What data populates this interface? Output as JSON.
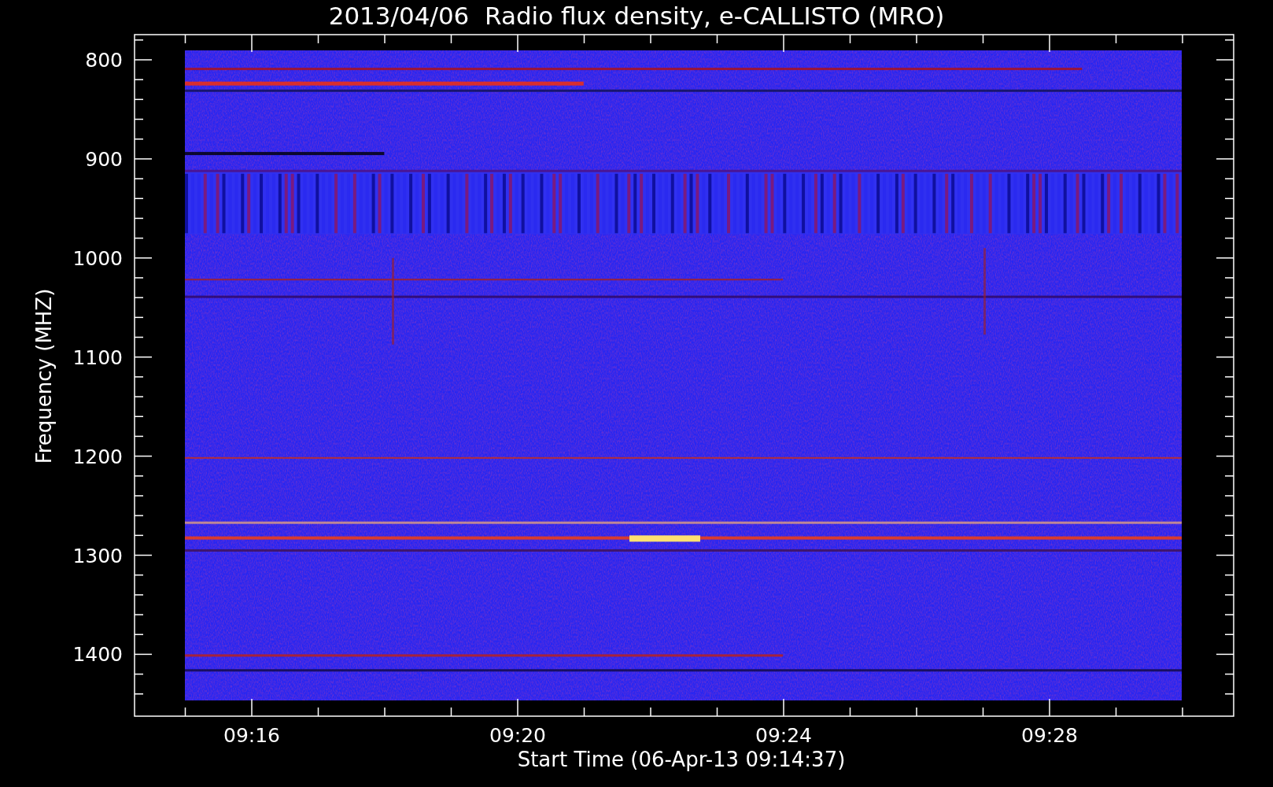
{
  "title": "2013/04/06  Radio flux density, e-CALLISTO (MRO)",
  "y_axis": {
    "label": "Frequency (MHZ)",
    "ticks": [
      "800",
      "900",
      "1000",
      "1100",
      "1200",
      "1300",
      "1400"
    ]
  },
  "x_axis": {
    "label": "Start Time (06-Apr-13 09:14:37)",
    "ticks": [
      "09:16",
      "09:20",
      "09:24",
      "09:28"
    ]
  }
}
